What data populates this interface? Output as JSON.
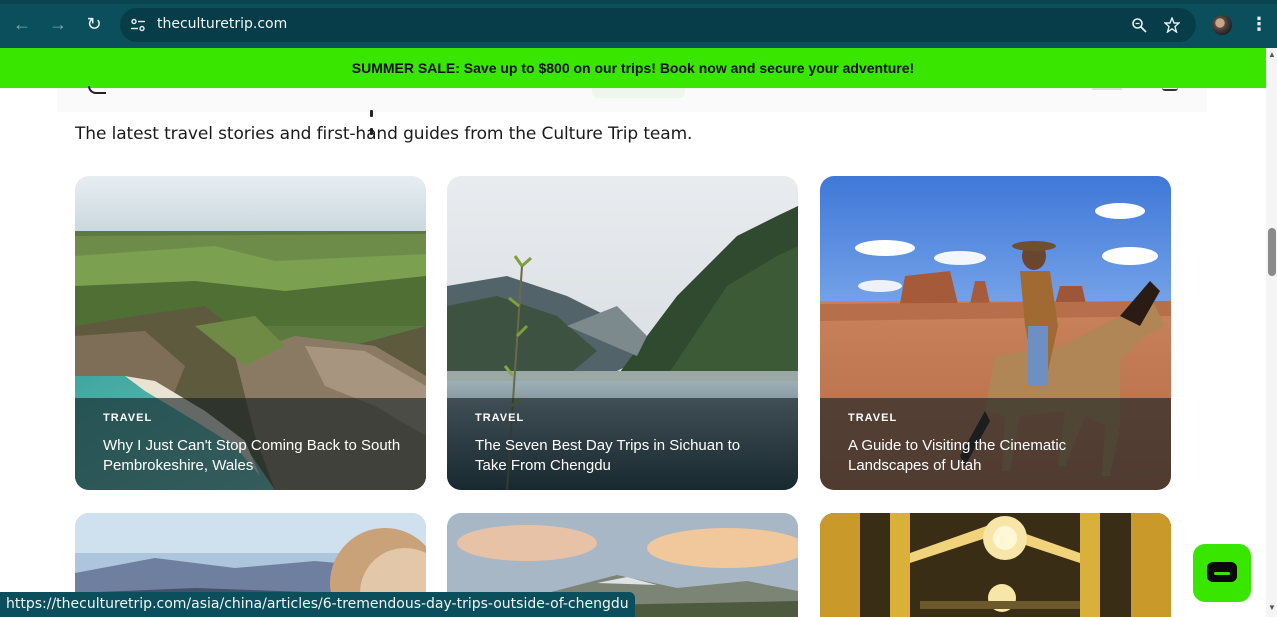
{
  "browser": {
    "url": "theculturetrip.com",
    "status_url": "https://theculturetrip.com/asia/china/articles/6-tremendous-day-trips-outside-of-chengdu",
    "icons": [
      "back-icon",
      "forward-icon",
      "reload-icon",
      "site-info-icon",
      "zoom-icon",
      "bookmark-star-icon",
      "profile-avatar",
      "menu-kebab-icon"
    ]
  },
  "promo": {
    "text": "SUMMER SALE: Save up to $800 on our trips! Book now and secure your adventure!",
    "color": "#39e600"
  },
  "page": {
    "subtitle": "The latest travel stories and first-hand guides from the Culture Trip team."
  },
  "cards": [
    {
      "tag": "TRAVEL",
      "title": "Why I Just Can't Stop Coming Back to South Pembrokeshire, Wales"
    },
    {
      "tag": "TRAVEL",
      "title": "The Seven Best Day Trips in Sichuan to Take From Chengdu"
    },
    {
      "tag": "TRAVEL",
      "title": "A Guide to Visiting the Cinematic Landscapes of Utah"
    }
  ],
  "chat": {
    "icon": "chat-bubble-icon"
  }
}
